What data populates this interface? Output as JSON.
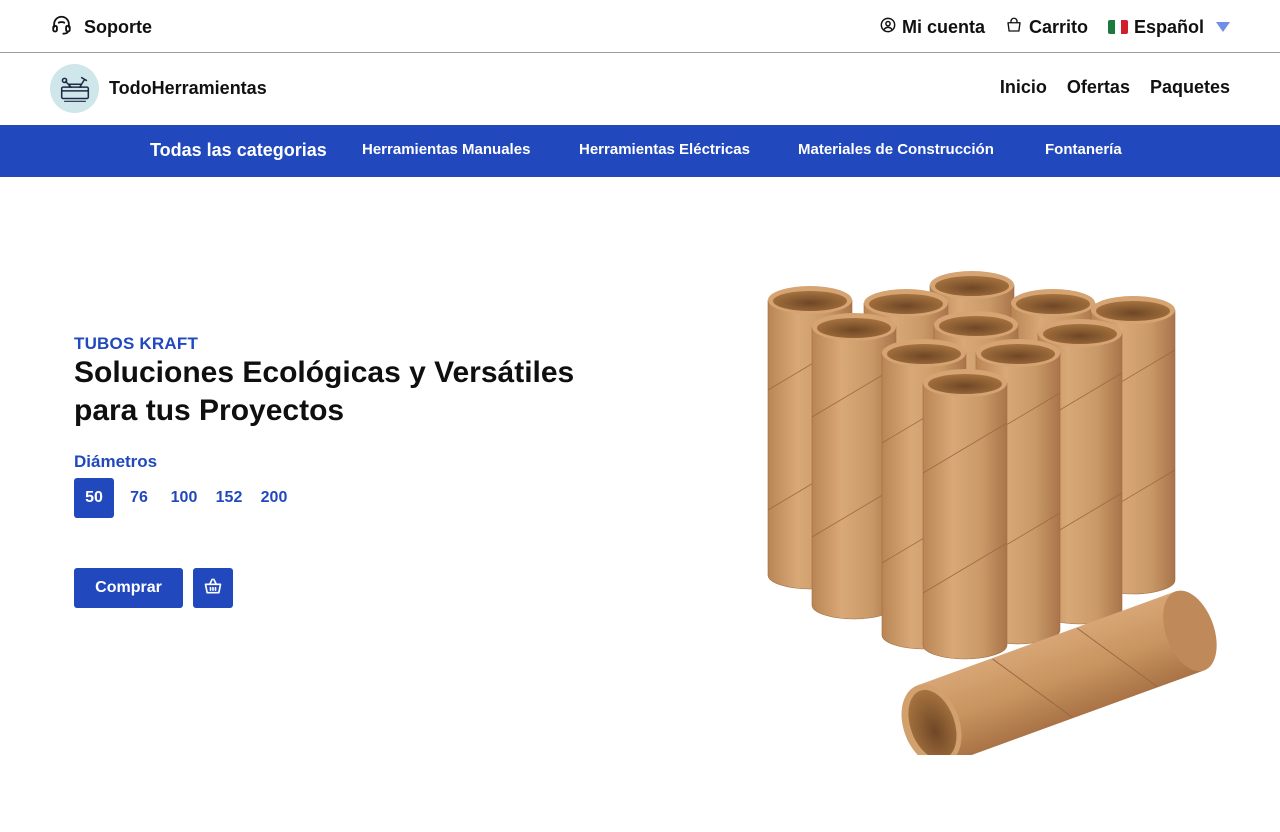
{
  "topbar": {
    "support_label": "Soporte",
    "account_label": "Mi cuenta",
    "cart_label": "Carrito",
    "language_label": "Español"
  },
  "header": {
    "brand_name": "TodoHerramientas",
    "nav": [
      "Inicio",
      "Ofertas",
      "Paquetes"
    ]
  },
  "categories": {
    "all_label": "Todas las categorias",
    "items": [
      "Herramientas Manuales",
      "Herramientas Eléctricas",
      "Materiales de Construcción",
      "Fontanería"
    ]
  },
  "hero": {
    "eyebrow": "TUBOS KRAFT",
    "title": "Soluciones Ecológicas y Versátiles para tus Proyectos",
    "diameters_label": "Diámetros",
    "diameters": [
      "50",
      "76",
      "100",
      "152",
      "200"
    ],
    "selected_diameter": "50",
    "buy_label": "Comprar"
  },
  "colors": {
    "accent": "#2149bd",
    "kraft": "#c99a68"
  }
}
